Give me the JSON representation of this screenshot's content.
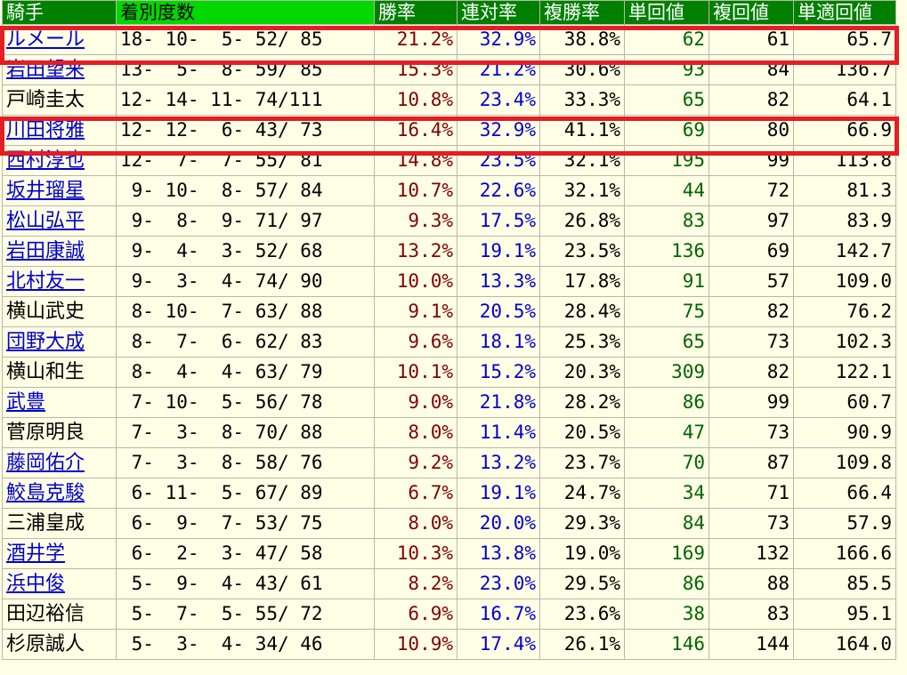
{
  "header": {
    "jockey": "騎手",
    "record": "着別度数",
    "win_rate": "勝率",
    "rentai_rate": "連対率",
    "fukusho_rate": "複勝率",
    "tan_value": "単回値",
    "fuku_value": "複回値",
    "tanteki_value": "単適回値"
  },
  "rows": [
    {
      "name": "ルメール",
      "rec": "18- 10-  5- 52/ 85",
      "win": "21.2%",
      "ren": "32.9%",
      "fuku": "38.8%",
      "tan": "62",
      "fukuv": "61",
      "tek": "65.7",
      "link": true
    },
    {
      "name": "岩田望来",
      "rec": "13-  5-  8- 59/ 85",
      "win": "15.3%",
      "ren": "21.2%",
      "fuku": "30.6%",
      "tan": "93",
      "fukuv": "84",
      "tek": "136.7",
      "link": true
    },
    {
      "name": "戸崎圭太",
      "rec": "12- 14- 11- 74/111",
      "win": "10.8%",
      "ren": "23.4%",
      "fuku": "33.3%",
      "tan": "65",
      "fukuv": "82",
      "tek": "64.1",
      "link": false
    },
    {
      "name": "川田将雅",
      "rec": "12- 12-  6- 43/ 73",
      "win": "16.4%",
      "ren": "32.9%",
      "fuku": "41.1%",
      "tan": "69",
      "fukuv": "80",
      "tek": "66.9",
      "link": true
    },
    {
      "name": "西村淳也",
      "rec": "12-  7-  7- 55/ 81",
      "win": "14.8%",
      "ren": "23.5%",
      "fuku": "32.1%",
      "tan": "195",
      "fukuv": "99",
      "tek": "113.8",
      "link": true
    },
    {
      "name": "坂井瑠星",
      "rec": " 9- 10-  8- 57/ 84",
      "win": "10.7%",
      "ren": "22.6%",
      "fuku": "32.1%",
      "tan": "44",
      "fukuv": "72",
      "tek": "81.3",
      "link": true
    },
    {
      "name": "松山弘平",
      "rec": " 9-  8-  9- 71/ 97",
      "win": "9.3%",
      "ren": "17.5%",
      "fuku": "26.8%",
      "tan": "83",
      "fukuv": "97",
      "tek": "83.9",
      "link": true
    },
    {
      "name": "岩田康誠",
      "rec": " 9-  4-  3- 52/ 68",
      "win": "13.2%",
      "ren": "19.1%",
      "fuku": "23.5%",
      "tan": "136",
      "fukuv": "69",
      "tek": "142.7",
      "link": true
    },
    {
      "name": "北村友一",
      "rec": " 9-  3-  4- 74/ 90",
      "win": "10.0%",
      "ren": "13.3%",
      "fuku": "17.8%",
      "tan": "91",
      "fukuv": "57",
      "tek": "109.0",
      "link": true
    },
    {
      "name": "横山武史",
      "rec": " 8- 10-  7- 63/ 88",
      "win": "9.1%",
      "ren": "20.5%",
      "fuku": "28.4%",
      "tan": "75",
      "fukuv": "82",
      "tek": "76.2",
      "link": false
    },
    {
      "name": "団野大成",
      "rec": " 8-  7-  6- 62/ 83",
      "win": "9.6%",
      "ren": "18.1%",
      "fuku": "25.3%",
      "tan": "65",
      "fukuv": "73",
      "tek": "102.3",
      "link": true
    },
    {
      "name": "横山和生",
      "rec": " 8-  4-  4- 63/ 79",
      "win": "10.1%",
      "ren": "15.2%",
      "fuku": "20.3%",
      "tan": "309",
      "fukuv": "82",
      "tek": "122.1",
      "link": false
    },
    {
      "name": "武豊",
      "rec": " 7- 10-  5- 56/ 78",
      "win": "9.0%",
      "ren": "21.8%",
      "fuku": "28.2%",
      "tan": "86",
      "fukuv": "99",
      "tek": "60.7",
      "link": true
    },
    {
      "name": "菅原明良",
      "rec": " 7-  3-  8- 70/ 88",
      "win": "8.0%",
      "ren": "11.4%",
      "fuku": "20.5%",
      "tan": "47",
      "fukuv": "73",
      "tek": "90.9",
      "link": false
    },
    {
      "name": "藤岡佑介",
      "rec": " 7-  3-  8- 58/ 76",
      "win": "9.2%",
      "ren": "13.2%",
      "fuku": "23.7%",
      "tan": "70",
      "fukuv": "87",
      "tek": "109.8",
      "link": true
    },
    {
      "name": "鮫島克駿",
      "rec": " 6- 11-  5- 67/ 89",
      "win": "6.7%",
      "ren": "19.1%",
      "fuku": "24.7%",
      "tan": "34",
      "fukuv": "71",
      "tek": "66.4",
      "link": true
    },
    {
      "name": "三浦皇成",
      "rec": " 6-  9-  7- 53/ 75",
      "win": "8.0%",
      "ren": "20.0%",
      "fuku": "29.3%",
      "tan": "84",
      "fukuv": "73",
      "tek": "57.9",
      "link": false
    },
    {
      "name": "酒井学",
      "rec": " 6-  2-  3- 47/ 58",
      "win": "10.3%",
      "ren": "13.8%",
      "fuku": "19.0%",
      "tan": "169",
      "fukuv": "132",
      "tek": "166.6",
      "link": true
    },
    {
      "name": "浜中俊",
      "rec": " 5-  9-  4- 43/ 61",
      "win": "8.2%",
      "ren": "23.0%",
      "fuku": "29.5%",
      "tan": "86",
      "fukuv": "88",
      "tek": "85.5",
      "link": true
    },
    {
      "name": "田辺裕信",
      "rec": " 5-  7-  5- 55/ 72",
      "win": "6.9%",
      "ren": "16.7%",
      "fuku": "23.6%",
      "tan": "38",
      "fukuv": "83",
      "tek": "95.1",
      "link": false
    },
    {
      "name": "杉原誠人",
      "rec": " 5-  3-  4- 34/ 46",
      "win": "10.9%",
      "ren": "17.4%",
      "fuku": "26.1%",
      "tan": "146",
      "fukuv": "144",
      "tek": "164.0",
      "link": false
    }
  ]
}
